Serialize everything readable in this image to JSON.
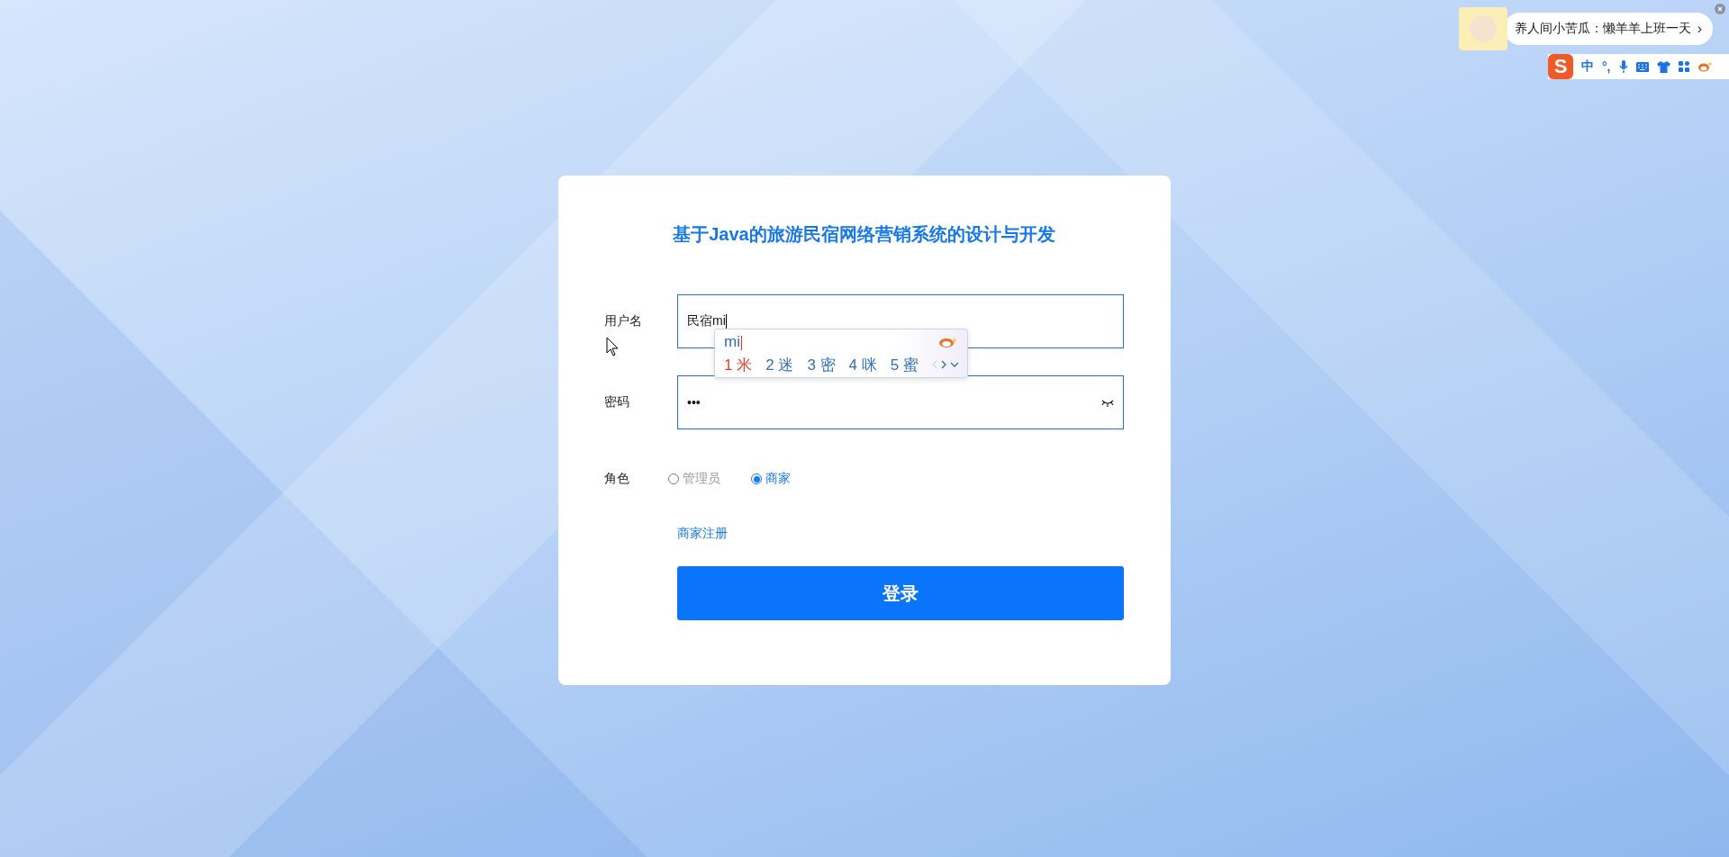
{
  "ime_notification": {
    "text": "养人间小苦瓜：懒羊羊上班一天",
    "arrow": "›"
  },
  "ime_toolbar": {
    "logo": "S",
    "mode": "中",
    "punctuation": "°,"
  },
  "login": {
    "title": "基于Java的旅游民宿网络营销系统的设计与开发",
    "fields": [
      {
        "label": "用户名",
        "kind": "text",
        "value": "民宿mi"
      },
      {
        "label": "密码",
        "kind": "password",
        "value": "•••"
      }
    ],
    "role": {
      "label": "角色",
      "options": [
        {
          "label": "管理员",
          "selected": false
        },
        {
          "label": "商家",
          "selected": true
        }
      ]
    },
    "register_link": "商家注册",
    "submit": "登录"
  },
  "ime_candidates": {
    "pinyin": "mi",
    "candidates": [
      {
        "index": "1",
        "text": "米",
        "selected": true
      },
      {
        "index": "2",
        "text": "迷",
        "selected": false
      },
      {
        "index": "3",
        "text": "密",
        "selected": false
      },
      {
        "index": "4",
        "text": "咪",
        "selected": false
      },
      {
        "index": "5",
        "text": "蜜",
        "selected": false
      }
    ]
  }
}
